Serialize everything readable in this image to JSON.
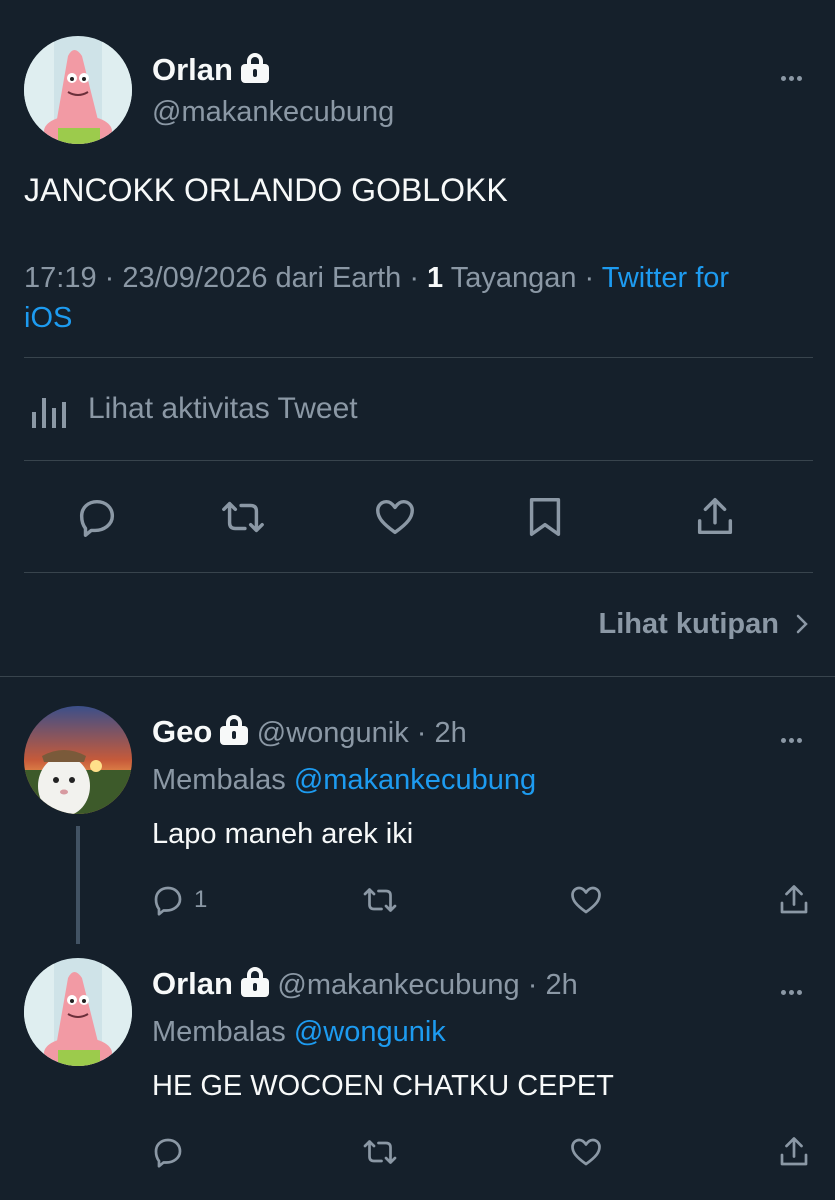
{
  "main_tweet": {
    "author_name": "Orlan",
    "author_handle": "@makankecubung",
    "text": "JANCOKK ORLANDO GOBLOKK",
    "meta_time_date": "17:19 · 23/09/2026 dari Earth · ",
    "views_count": "1",
    "views_label": " Tayangan · ",
    "client_line1": "Twitter for",
    "client_line2": "iOS",
    "activity_label": "Lihat aktivitas Tweet",
    "quotes_link": "Lihat kutipan"
  },
  "replies": [
    {
      "author_name": "Geo",
      "author_handle": "@wongunik · 2h",
      "replying_prefix": "Membalas ",
      "replying_to": "@makankecubung",
      "text": "Lapo maneh arek iki",
      "reply_count": "1"
    },
    {
      "author_name": "Orlan",
      "author_handle": "@makankecubung · 2h",
      "replying_prefix": "Membalas ",
      "replying_to": "@wongunik",
      "text": "HE GE WOCOEN CHATKU CEPET",
      "reply_count": ""
    }
  ],
  "colors": {
    "background": "#15202b",
    "text": "#f7f9f9",
    "muted": "#8b98a5",
    "accent": "#1d9bf0",
    "divider": "#38444d"
  },
  "icons": [
    "lock-icon",
    "more-icon",
    "chart-icon",
    "reply-icon",
    "retweet-icon",
    "like-icon",
    "bookmark-icon",
    "share-icon",
    "chevron-right-icon"
  ]
}
